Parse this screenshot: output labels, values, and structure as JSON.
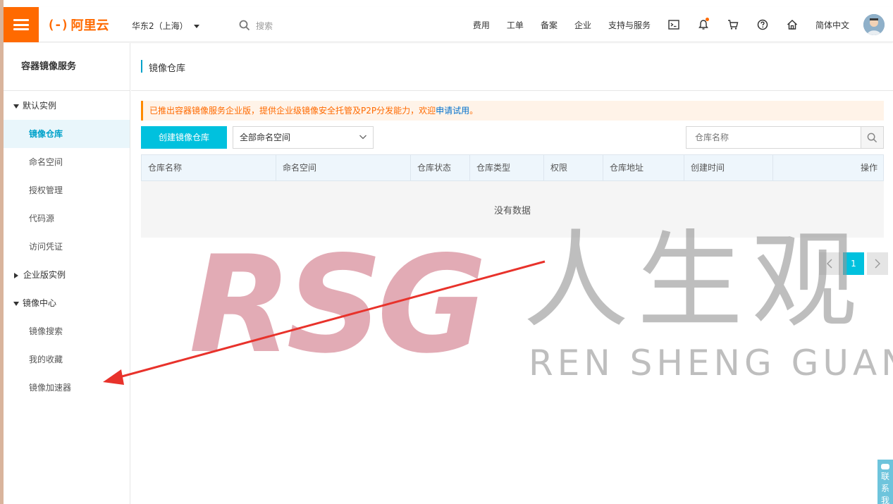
{
  "topbar": {
    "logo_mark": "(-)",
    "logo_text": "阿里云",
    "region": "华东2（上海）",
    "search_placeholder": "搜索",
    "nav": [
      "费用",
      "工单",
      "备案",
      "企业",
      "支持与服务"
    ],
    "language": "简体中文",
    "icons": [
      "terminal-icon",
      "bell-icon",
      "cart-icon",
      "help-icon",
      "home-icon"
    ]
  },
  "sidebar": {
    "title": "容器镜像服务",
    "group_default": "默认实例",
    "items_default": [
      "镜像仓库",
      "命名空间",
      "授权管理",
      "代码源",
      "访问凭证"
    ],
    "group_enterprise": "企业版实例",
    "group_center": "镜像中心",
    "items_center": [
      "镜像搜索",
      "我的收藏",
      "镜像加速器"
    ]
  },
  "main": {
    "page_title": "镜像仓库",
    "notice_text": "已推出容器镜像服务企业版，提供企业级镜像安全托管及P2P分发能力，欢迎",
    "notice_link": "申请试用",
    "notice_end": "。",
    "create_button": "创建镜像仓库",
    "namespace_select": "全部命名空间",
    "repo_search_placeholder": "仓库名称",
    "columns": [
      "仓库名称",
      "命名空间",
      "仓库状态",
      "仓库类型",
      "权限",
      "仓库地址",
      "创建时间",
      "操作"
    ],
    "empty_text": "没有数据",
    "current_page": "1"
  },
  "watermark": {
    "logo": "RSG",
    "chinese": "人生观",
    "english": "REN SHENG GUAN"
  },
  "contact": {
    "label": "联系我"
  },
  "colors": {
    "brand_orange": "#ff6a00",
    "accent_cyan": "#00c1de",
    "active_text": "#00a2ca",
    "annotation_arrow": "#e8322b"
  }
}
